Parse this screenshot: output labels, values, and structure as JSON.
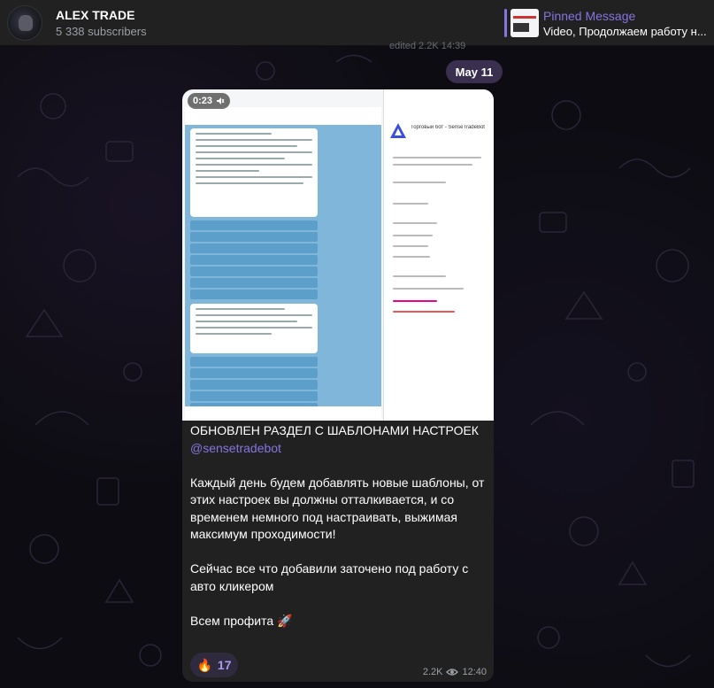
{
  "header": {
    "title": "ALEX TRADE",
    "subscribers": "5 338 subscribers",
    "pinned_label": "Pinned Message",
    "pinned_text": "Video, Продолжаем работу н..."
  },
  "prev_message": {
    "meta": "edited 2.2K 14:39"
  },
  "date_chip": "May 11",
  "message": {
    "video_duration": "0:23",
    "caption_title": "ОБНОВЛЕН РАЗДЕЛ С ШАБЛОНАМИ НАСТРОЕК ",
    "caption_mention": "@sensetradebot",
    "caption_p2": "Каждый день будем добавлять новые шаблоны, от этих настроек вы должны отталкивается, и со временем немного под настраивать, выжимая максимум проходимости!",
    "caption_p3": "Сейчас все что добавили заточено под работу с авто кликером",
    "caption_p4": "Всем профита 🚀",
    "reaction_emoji": "🔥",
    "reaction_count": "17",
    "views": "2.2K",
    "time": "12:40"
  },
  "video_screen": {
    "panel_title": "Торговый бот - SenseTradeBot"
  }
}
